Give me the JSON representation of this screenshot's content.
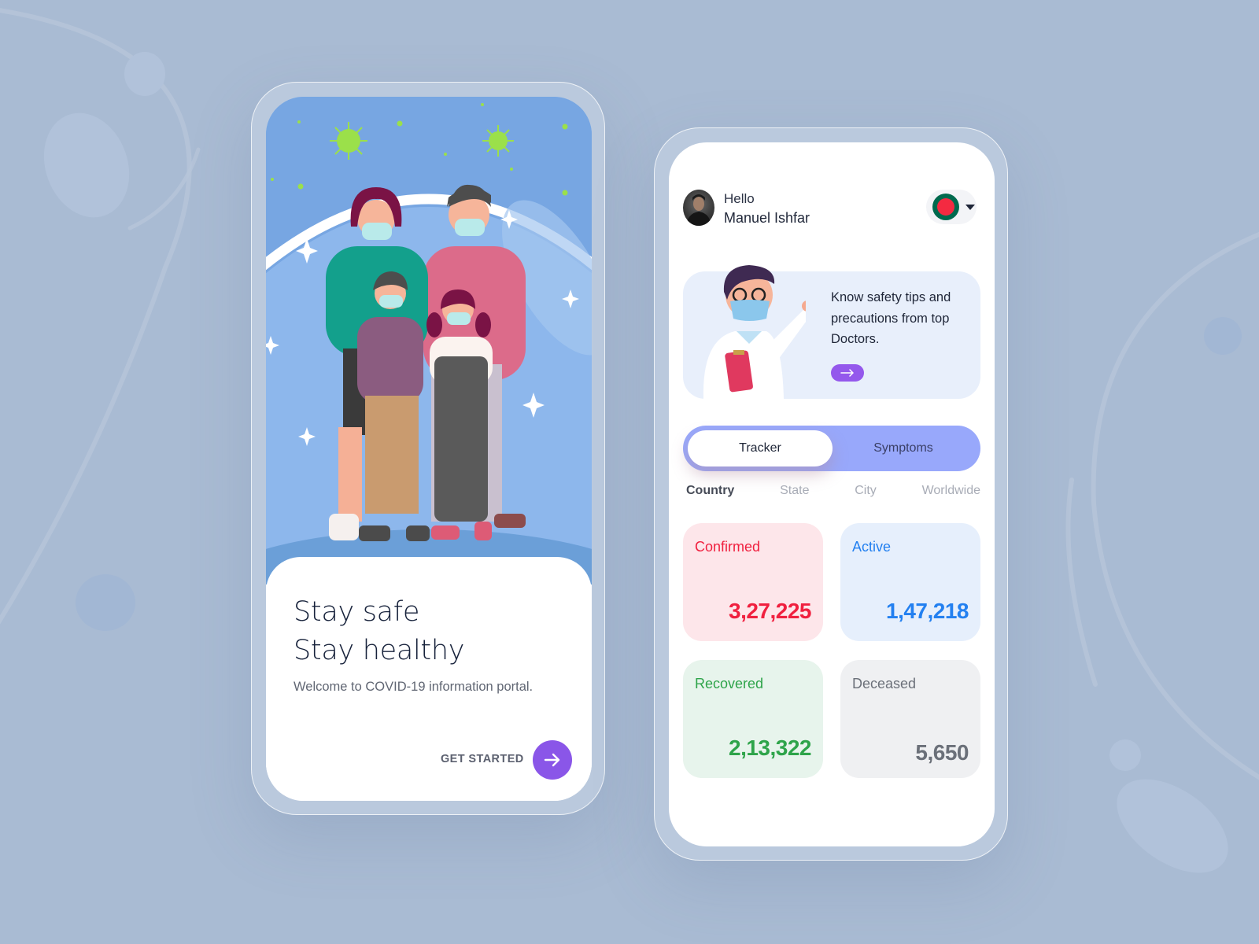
{
  "colors": {
    "background": "#a9bbd3",
    "accent_purple": "#8a56e8",
    "segment_blue": "#98a8fb",
    "confirmed": "#f0203f",
    "active": "#2380f0",
    "recovered": "#2ea44a",
    "deceased": "#6b7079"
  },
  "onboarding": {
    "title_line1": "Stay safe",
    "title_line2": "Stay healthy",
    "subtitle": "Welcome to COVID-19 information portal.",
    "cta_label": "GET STARTED",
    "cta_icon": "arrow-right-icon",
    "illustration": "family-wearing-masks-under-protective-dome"
  },
  "dashboard": {
    "greeting": "Hello",
    "user_name": "Manuel Ishfar",
    "country_flag": "bangladesh-flag",
    "promo": {
      "text": "Know safety tips and precautions from top Doctors.",
      "button_icon": "arrow-right-icon",
      "illustration": "doctor-with-mask-and-clipboard"
    },
    "tabs": [
      {
        "label": "Tracker",
        "active": true
      },
      {
        "label": "Symptoms",
        "active": false
      }
    ],
    "filters": [
      {
        "label": "Country",
        "active": true
      },
      {
        "label": "State",
        "active": false
      },
      {
        "label": "City",
        "active": false
      },
      {
        "label": "Worldwide",
        "active": false
      }
    ],
    "stats": [
      {
        "label": "Confirmed",
        "value": "3,27,225"
      },
      {
        "label": "Active",
        "value": "1,47,218"
      },
      {
        "label": "Recovered",
        "value": "2,13,322"
      },
      {
        "label": "Deceased",
        "value": "5,650"
      }
    ]
  }
}
